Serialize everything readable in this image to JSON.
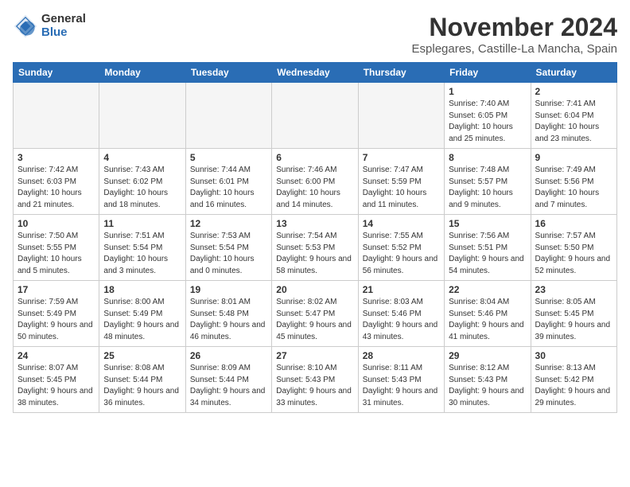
{
  "header": {
    "logo_general": "General",
    "logo_blue": "Blue",
    "month_title": "November 2024",
    "location": "Esplegares, Castille-La Mancha, Spain"
  },
  "weekdays": [
    "Sunday",
    "Monday",
    "Tuesday",
    "Wednesday",
    "Thursday",
    "Friday",
    "Saturday"
  ],
  "weeks": [
    [
      {
        "date": "",
        "info": ""
      },
      {
        "date": "",
        "info": ""
      },
      {
        "date": "",
        "info": ""
      },
      {
        "date": "",
        "info": ""
      },
      {
        "date": "",
        "info": ""
      },
      {
        "date": "1",
        "info": "Sunrise: 7:40 AM\nSunset: 6:05 PM\nDaylight: 10 hours and 25 minutes."
      },
      {
        "date": "2",
        "info": "Sunrise: 7:41 AM\nSunset: 6:04 PM\nDaylight: 10 hours and 23 minutes."
      }
    ],
    [
      {
        "date": "3",
        "info": "Sunrise: 7:42 AM\nSunset: 6:03 PM\nDaylight: 10 hours and 21 minutes."
      },
      {
        "date": "4",
        "info": "Sunrise: 7:43 AM\nSunset: 6:02 PM\nDaylight: 10 hours and 18 minutes."
      },
      {
        "date": "5",
        "info": "Sunrise: 7:44 AM\nSunset: 6:01 PM\nDaylight: 10 hours and 16 minutes."
      },
      {
        "date": "6",
        "info": "Sunrise: 7:46 AM\nSunset: 6:00 PM\nDaylight: 10 hours and 14 minutes."
      },
      {
        "date": "7",
        "info": "Sunrise: 7:47 AM\nSunset: 5:59 PM\nDaylight: 10 hours and 11 minutes."
      },
      {
        "date": "8",
        "info": "Sunrise: 7:48 AM\nSunset: 5:57 PM\nDaylight: 10 hours and 9 minutes."
      },
      {
        "date": "9",
        "info": "Sunrise: 7:49 AM\nSunset: 5:56 PM\nDaylight: 10 hours and 7 minutes."
      }
    ],
    [
      {
        "date": "10",
        "info": "Sunrise: 7:50 AM\nSunset: 5:55 PM\nDaylight: 10 hours and 5 minutes."
      },
      {
        "date": "11",
        "info": "Sunrise: 7:51 AM\nSunset: 5:54 PM\nDaylight: 10 hours and 3 minutes."
      },
      {
        "date": "12",
        "info": "Sunrise: 7:53 AM\nSunset: 5:54 PM\nDaylight: 10 hours and 0 minutes."
      },
      {
        "date": "13",
        "info": "Sunrise: 7:54 AM\nSunset: 5:53 PM\nDaylight: 9 hours and 58 minutes."
      },
      {
        "date": "14",
        "info": "Sunrise: 7:55 AM\nSunset: 5:52 PM\nDaylight: 9 hours and 56 minutes."
      },
      {
        "date": "15",
        "info": "Sunrise: 7:56 AM\nSunset: 5:51 PM\nDaylight: 9 hours and 54 minutes."
      },
      {
        "date": "16",
        "info": "Sunrise: 7:57 AM\nSunset: 5:50 PM\nDaylight: 9 hours and 52 minutes."
      }
    ],
    [
      {
        "date": "17",
        "info": "Sunrise: 7:59 AM\nSunset: 5:49 PM\nDaylight: 9 hours and 50 minutes."
      },
      {
        "date": "18",
        "info": "Sunrise: 8:00 AM\nSunset: 5:49 PM\nDaylight: 9 hours and 48 minutes."
      },
      {
        "date": "19",
        "info": "Sunrise: 8:01 AM\nSunset: 5:48 PM\nDaylight: 9 hours and 46 minutes."
      },
      {
        "date": "20",
        "info": "Sunrise: 8:02 AM\nSunset: 5:47 PM\nDaylight: 9 hours and 45 minutes."
      },
      {
        "date": "21",
        "info": "Sunrise: 8:03 AM\nSunset: 5:46 PM\nDaylight: 9 hours and 43 minutes."
      },
      {
        "date": "22",
        "info": "Sunrise: 8:04 AM\nSunset: 5:46 PM\nDaylight: 9 hours and 41 minutes."
      },
      {
        "date": "23",
        "info": "Sunrise: 8:05 AM\nSunset: 5:45 PM\nDaylight: 9 hours and 39 minutes."
      }
    ],
    [
      {
        "date": "24",
        "info": "Sunrise: 8:07 AM\nSunset: 5:45 PM\nDaylight: 9 hours and 38 minutes."
      },
      {
        "date": "25",
        "info": "Sunrise: 8:08 AM\nSunset: 5:44 PM\nDaylight: 9 hours and 36 minutes."
      },
      {
        "date": "26",
        "info": "Sunrise: 8:09 AM\nSunset: 5:44 PM\nDaylight: 9 hours and 34 minutes."
      },
      {
        "date": "27",
        "info": "Sunrise: 8:10 AM\nSunset: 5:43 PM\nDaylight: 9 hours and 33 minutes."
      },
      {
        "date": "28",
        "info": "Sunrise: 8:11 AM\nSunset: 5:43 PM\nDaylight: 9 hours and 31 minutes."
      },
      {
        "date": "29",
        "info": "Sunrise: 8:12 AM\nSunset: 5:43 PM\nDaylight: 9 hours and 30 minutes."
      },
      {
        "date": "30",
        "info": "Sunrise: 8:13 AM\nSunset: 5:42 PM\nDaylight: 9 hours and 29 minutes."
      }
    ]
  ]
}
